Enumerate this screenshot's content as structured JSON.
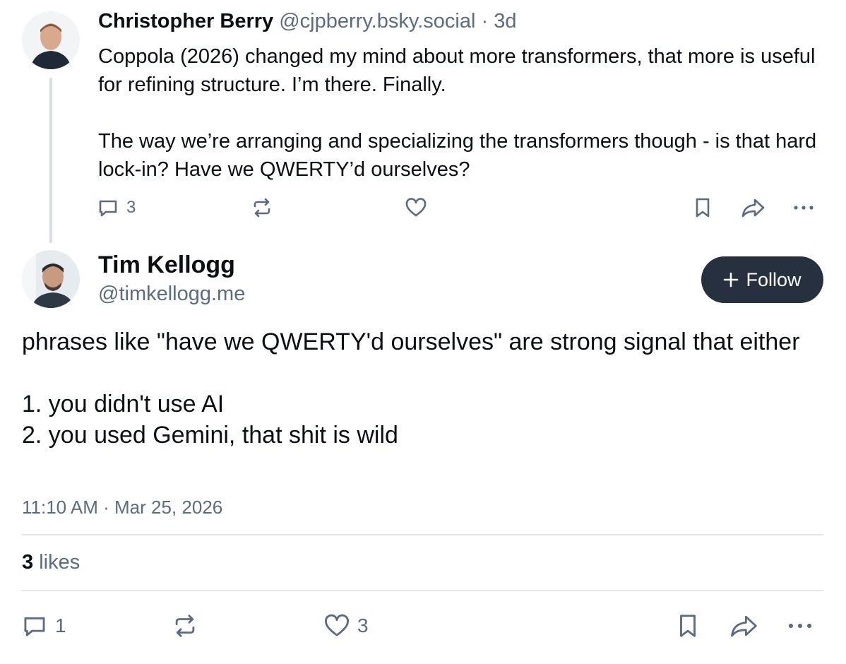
{
  "parent_post": {
    "author_name": "Christopher Berry",
    "author_handle": "@cjpberry.bsky.social",
    "separator": "·",
    "age": "3d",
    "text_paragraphs": [
      "Coppola (2026) changed my mind about more transformers, that more is useful for refining structure. I’m there. Finally.",
      "The way we’re arranging and specializing the transformers though - is that hard lock-in? Have we QWERTY’d ourselves?"
    ],
    "reply_count": "3",
    "repost_count": "",
    "like_count": ""
  },
  "main_post": {
    "author_name": "Tim Kellogg",
    "author_handle": "@timkellogg.me",
    "follow_label": "Follow",
    "text_lines": [
      "phrases like \"have we QWERTY'd ourselves\" are strong signal that either",
      "1. you didn't use AI",
      "2. you used Gemini, that shit is wild"
    ],
    "timestamp": "11:10 AM · Mar 25, 2026",
    "likes_count": "3",
    "likes_label": "likes",
    "reply_count": "1",
    "repost_count": "",
    "like_count": "3"
  },
  "colors": {
    "text": "#0b0f14",
    "muted": "#5b6b80",
    "follow_bg": "#26303e",
    "divider": "#e3e6ea"
  },
  "icons": [
    "reply-icon",
    "repost-icon",
    "like-icon",
    "bookmark-icon",
    "share-icon",
    "more-icon",
    "plus-icon"
  ]
}
